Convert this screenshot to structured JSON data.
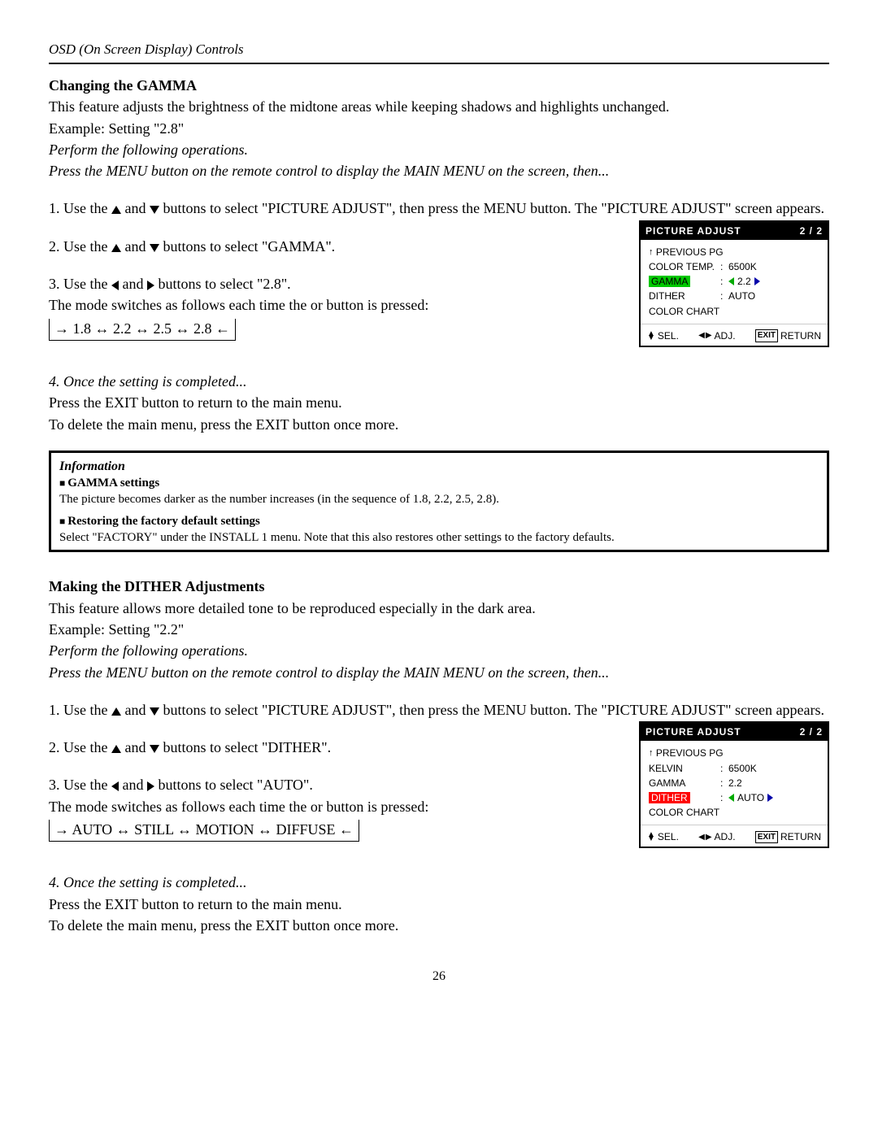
{
  "header": "OSD (On Screen Display) Controls",
  "gamma": {
    "title": "Changing the GAMMA",
    "desc": "This feature adjusts the brightness of the midtone areas while keeping shadows and highlights unchanged.",
    "example": "Example: Setting \"2.8\"",
    "perform": "Perform the following operations.",
    "pressMenu": "Press the MENU button on the remote control to display the MAIN MENU on the screen, then...",
    "step1a": "1. Use the ",
    "step1b": " and ",
    "step1c": " buttons to select \"PICTURE ADJUST\", then press the MENU button. The \"PICTURE ADJUST\" screen appears.",
    "step2a": "2. Use the ",
    "step2b": " and ",
    "step2c": " buttons to select \"GAMMA\".",
    "step3a": "3. Use the ",
    "step3b": " and ",
    "step3c": " buttons to select \"2.8\".",
    "modeSwitch": "The mode switches as follows each time the  or  button is pressed:",
    "seq": "1.8 ↔ 2.2 ↔ 2.5 ↔ 2.8",
    "step4": "4. Once the setting is completed...",
    "exit1": "Press the EXIT button to return to the main menu.",
    "exit2": "To delete the main menu, press the EXIT button once more."
  },
  "osd1": {
    "title": "PICTURE ADJUST",
    "page": "2 / 2",
    "prev": "PREVIOUS PG",
    "r1l": "COLOR TEMP.",
    "r1v": "6500K",
    "r2l": "GAMMA",
    "r2v": "2.2",
    "r3l": "DITHER",
    "r3v": "AUTO",
    "r4l": "COLOR CHART",
    "sel": "SEL.",
    "adj": "ADJ.",
    "exit": "EXIT",
    "ret": "RETURN"
  },
  "info": {
    "title": "Information",
    "sub1": "GAMMA settings",
    "txt1": "The picture becomes darker as the number increases (in the sequence of 1.8, 2.2, 2.5, 2.8).",
    "sub2": "Restoring the factory default settings",
    "txt2": "Select \"FACTORY\" under the INSTALL 1 menu. Note that this also restores other settings to the factory defaults."
  },
  "dither": {
    "title": "Making the DITHER Adjustments",
    "desc": "This feature allows more detailed tone to be reproduced especially in the dark area.",
    "example": "Example: Setting \"2.2\"",
    "perform": "Perform the following operations.",
    "pressMenu": "Press the MENU button on the remote control to display the MAIN MENU on the screen, then...",
    "step1a": "1. Use the ",
    "step1b": " and ",
    "step1c": " buttons to select \"PICTURE ADJUST\", then press the MENU button. The \"PICTURE ADJUST\" screen appears.",
    "step2a": "2. Use the ",
    "step2b": " and ",
    "step2c": " buttons to select \"DITHER\".",
    "step3a": "3. Use the ",
    "step3b": " and ",
    "step3c": " buttons to select \"AUTO\".",
    "modeSwitch": "The mode switches as follows each time the  or  button is pressed:",
    "seq": "AUTO ↔ STILL ↔ MOTION ↔ DIFFUSE",
    "step4": "4. Once the setting is completed...",
    "exit1": "Press the EXIT button to return to the main menu.",
    "exit2": "To delete the main menu, press the EXIT button once more."
  },
  "osd2": {
    "title": "PICTURE ADJUST",
    "page": "2 / 2",
    "prev": "PREVIOUS PG",
    "r1l": "KELVIN",
    "r1v": "6500K",
    "r2l": "GAMMA",
    "r2v": "2.2",
    "r3l": "DITHER",
    "r3v": "AUTO",
    "r4l": "COLOR CHART",
    "sel": "SEL.",
    "adj": "ADJ.",
    "exit": "EXIT",
    "ret": "RETURN"
  },
  "pageNum": "26"
}
